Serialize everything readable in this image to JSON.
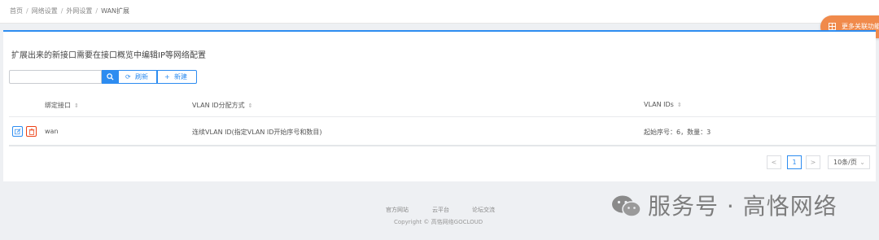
{
  "breadcrumb": {
    "items": [
      "首页",
      "网络设置",
      "外网设置",
      "WAN扩展"
    ],
    "separator": "/"
  },
  "feature_button": {
    "label": "更多关联功能",
    "icon": "grid-icon",
    "color": "#f08a4b"
  },
  "notice": "扩展出来的新接口需要在接口概览中编辑IP等网络配置",
  "toolbar": {
    "search_value": "",
    "search_placeholder": "",
    "search_icon": "search-icon",
    "refresh_label": "刷新",
    "refresh_icon": "refresh-icon",
    "new_label": "新建",
    "new_icon": "plus-icon",
    "accent": "#2d8cf0"
  },
  "table": {
    "columns": [
      "绑定接口",
      "VLAN ID分配方式",
      "VLAN IDs"
    ],
    "sort_icon": "sort-icon",
    "rows": [
      {
        "interface": "wan",
        "mode": "连续VLAN ID(指定VLAN ID开始序号和数目)",
        "vlan_ids": "起始序号：6，数量：3"
      }
    ]
  },
  "pagination": {
    "prev": "<",
    "current": "1",
    "next": ">",
    "page_size": "10条/页"
  },
  "footer": {
    "links": [
      "官方网站",
      "云平台",
      "论坛交流"
    ],
    "copyright": "Copyright © 高恪网络GOCLOUD"
  },
  "watermark": {
    "text": "服务号 · 高恪网络",
    "icon": "wechat-icon"
  }
}
